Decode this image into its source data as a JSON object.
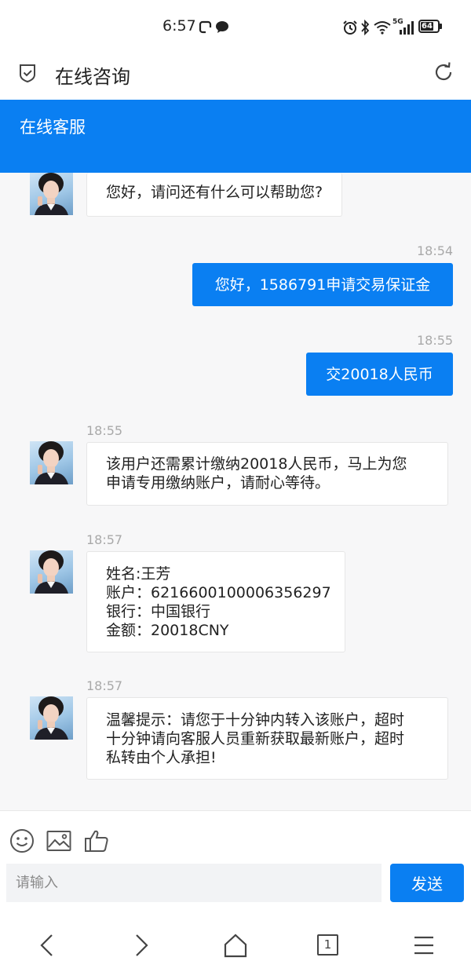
{
  "status_bar": {
    "time": "6:57",
    "network": "5G",
    "battery": "64"
  },
  "title_bar": {
    "title": "在线咨询"
  },
  "chat_header": {
    "title": "在线客服"
  },
  "messages": [
    {
      "side": "in",
      "time": "",
      "lines": [
        "您好，请问还有什么可以帮助您?"
      ]
    },
    {
      "side": "out",
      "time": "18:54",
      "lines": [
        "您好，1586791申请交易保证金"
      ]
    },
    {
      "side": "out",
      "time": "18:55",
      "lines": [
        "交20018人民币"
      ]
    },
    {
      "side": "in",
      "time": "18:55",
      "lines": [
        "该用户还需累计缴纳20018人民币，马上为您",
        "申请专用缴纳账户，请耐心等待。"
      ]
    },
    {
      "side": "in",
      "time": "18:57",
      "lines": [
        "姓名:王芳",
        "账户：6216600100006356297",
        "银行：中国银行",
        "金额：20018CNY"
      ]
    },
    {
      "side": "in",
      "time": "18:57",
      "lines": [
        "温馨提示：请您于十分钟内转入该账户，超时",
        "十分钟请向客服人员重新获取最新账户，超时",
        "私转由个人承担!"
      ]
    }
  ],
  "composer": {
    "placeholder": "请输入",
    "value": "",
    "send_label": "发送",
    "tools": [
      "emoji-icon",
      "image-icon",
      "thumbs-up-icon"
    ]
  },
  "nav_bar": {
    "tab_count": "1",
    "buttons": [
      "back-icon",
      "forward-icon",
      "home-icon",
      "tabs-icon",
      "menu-icon"
    ]
  },
  "colors": {
    "accent": "#0a7ff2",
    "chat_bg": "#f7f7f8",
    "timestamp": "#a9a9a9"
  }
}
